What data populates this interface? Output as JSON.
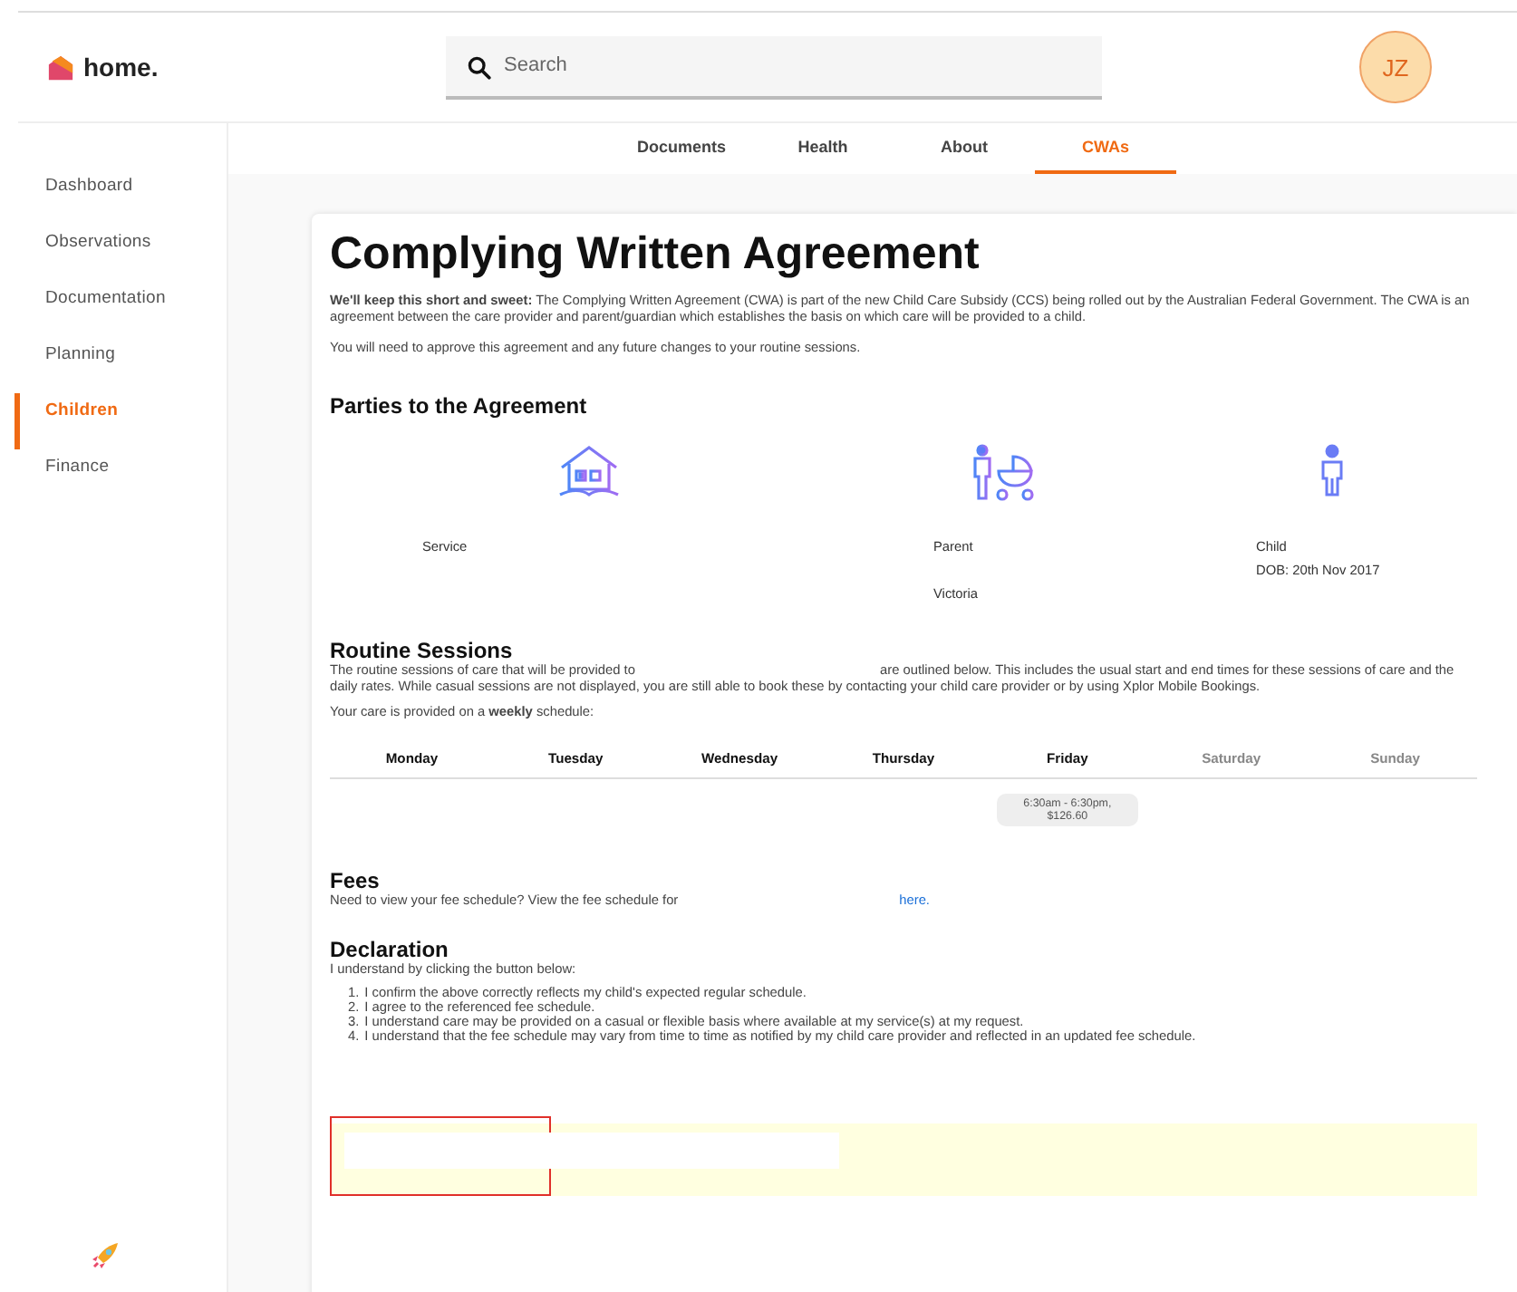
{
  "header": {
    "logo": "home.",
    "search": {
      "placeholder": "Search"
    },
    "avatar": "JZ"
  },
  "sidebar": {
    "items": [
      {
        "label": "Dashboard",
        "selected": false
      },
      {
        "label": "Observations",
        "selected": false
      },
      {
        "label": "Documentation",
        "selected": false
      },
      {
        "label": "Planning",
        "selected": false
      },
      {
        "label": "Children",
        "selected": true
      },
      {
        "label": "Finance",
        "selected": false
      }
    ]
  },
  "tabs": [
    {
      "label": "Documents",
      "selected": false
    },
    {
      "label": "Health",
      "selected": false
    },
    {
      "label": "About",
      "selected": false
    },
    {
      "label": "CWAs",
      "selected": true
    }
  ],
  "agreement": {
    "title": "Complying Written Agreement",
    "intro": "**We'll keep this short and sweet:** The Complying Written Agreement (CWA) is part of the new Child Care Subsidy (CCS) being rolled out by the Australian Federal Government. The CWA is an agreement between the care provider and parent/guardian which establishes the basis on which care will be provided to a child.",
    "approve": "You will need to approve this agreement and any future changes to your routine sessions.",
    "parties_heading": "Parties to the Agreement",
    "parties": [
      {
        "kind": "service",
        "label": "Service"
      },
      {
        "kind": "parent",
        "label": "Parent",
        "detail": "Victoria"
      },
      {
        "kind": "child",
        "label": "Child",
        "detail": "DOB: 20th Nov 2017"
      }
    ],
    "sessions_heading": "Routine Sessions",
    "sessions_text_start": "The routine sessions of care that will be provided to",
    "sessions_text_end": "are outlined below. This includes the usual start and end times for these sessions of care and the daily rates. While casual sessions are not displayed, you are still able to book these by contacting your child care provider or by using Xplor Mobile Bookings.",
    "schedule_note": "Your care is provided on a **weekly** schedule:",
    "days": [
      {
        "name": "Monday",
        "disabled": false
      },
      {
        "name": "Tuesday",
        "disabled": false
      },
      {
        "name": "Wednesday",
        "disabled": false
      },
      {
        "name": "Thursday",
        "disabled": false
      },
      {
        "name": "Friday",
        "disabled": false,
        "session": "6:30am - 6:30pm, $126.60"
      },
      {
        "name": "Saturday",
        "disabled": true
      },
      {
        "name": "Sunday",
        "disabled": true
      }
    ],
    "fees_heading": "Fees",
    "fees_text": "Need to view your fee schedule? View the fee schedule for",
    "fees_link": "here.",
    "declaration_heading": "Declaration",
    "declaration_intro": "I understand by clicking the button below:",
    "declarations": [
      {
        "number": "1.",
        "text": "I confirm the above correctly reflects my child's expected regular schedule."
      },
      {
        "number": "2.",
        "text": "I agree to the referenced fee schedule."
      },
      {
        "number": "3.",
        "text": "I understand care may be provided on a casual or flexible basis where available at my service(s) at my request."
      },
      {
        "number": "4.",
        "text": "I understand that the fee schedule may vary from time to time as notified by my child care provider and reflected in an updated fee schedule."
      }
    ]
  }
}
